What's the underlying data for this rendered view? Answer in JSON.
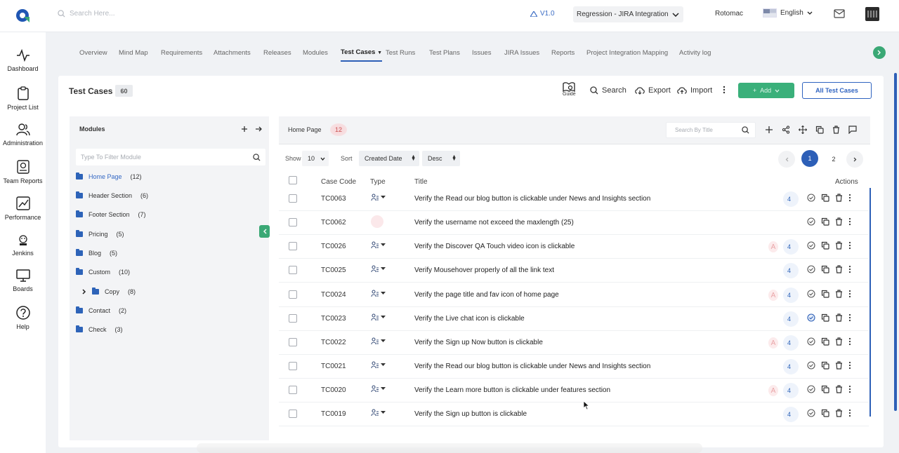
{
  "topbar": {
    "search_placeholder": "Search Here...",
    "version": "V1.0",
    "project": "Regression - JIRA Integration",
    "user": "Rotomac",
    "language": "English"
  },
  "sidebar": {
    "items": [
      {
        "label": "Dashboard",
        "icon": "pulse-icon"
      },
      {
        "label": "Project List",
        "icon": "clipboard-icon"
      },
      {
        "label": "Administration",
        "icon": "users-icon"
      },
      {
        "label": "Team Reports",
        "icon": "report-icon"
      },
      {
        "label": "Performance",
        "icon": "performance-icon"
      },
      {
        "label": "Jenkins",
        "icon": "jenkins-icon"
      },
      {
        "label": "Boards",
        "icon": "monitor-icon"
      },
      {
        "label": "Help",
        "icon": "help-icon"
      }
    ]
  },
  "tabs": [
    "Overview",
    "Mind Map",
    "Requirements",
    "Attachments",
    "Releases",
    "Modules",
    "Test Cases",
    "Test Runs",
    "Test Plans",
    "Issues",
    "JIRA Issues",
    "Reports",
    "Project Integration Mapping",
    "Activity log"
  ],
  "header": {
    "title": "Test Cases",
    "count": "60",
    "guide": "Guide",
    "search": "Search",
    "export": "Export",
    "import": "Import",
    "add": "Add",
    "all": "All Test Cases"
  },
  "modules": {
    "title": "Modules",
    "filter_placeholder": "Type To Filter Module",
    "items": [
      {
        "name": "Home Page",
        "count": "(12)"
      },
      {
        "name": "Header Section",
        "count": "(6)"
      },
      {
        "name": "Footer Section",
        "count": "(7)"
      },
      {
        "name": "Pricing",
        "count": "(5)"
      },
      {
        "name": "Blog",
        "count": "(5)"
      },
      {
        "name": "Custom",
        "count": "(10)"
      },
      {
        "name": "Copy",
        "count": "(8)"
      },
      {
        "name": "Contact",
        "count": "(2)"
      },
      {
        "name": "Check",
        "count": "(3)"
      }
    ]
  },
  "list": {
    "module": "Home Page",
    "count": "12",
    "search_placeholder": "Search By Title",
    "show_label": "Show",
    "show_value": "10",
    "sort_label": "Sort",
    "sort_value": "Created Date",
    "order_value": "Desc",
    "pages": [
      "1",
      "2"
    ],
    "headers": {
      "code": "Case Code",
      "type": "Type",
      "title": "Title",
      "actions": "Actions"
    },
    "rows": [
      {
        "code": "TC0063",
        "title": "Verify the Read our blog button is clickable under News and Insights section",
        "count": "4",
        "a": false
      },
      {
        "code": "TC0062",
        "title": "Verify the username not exceed the maxlength (25)",
        "count": "",
        "a": false
      },
      {
        "code": "TC0026",
        "title": "Verify the Discover QA Touch video icon is clickable",
        "count": "4",
        "a": true
      },
      {
        "code": "TC0025",
        "title": "Verify Mousehover properly of all the link text",
        "count": "4",
        "a": false
      },
      {
        "code": "TC0024",
        "title": "Verify the page title and fav icon of home page",
        "count": "4",
        "a": true
      },
      {
        "code": "TC0023",
        "title": "Verify the Live chat icon is clickable",
        "count": "4",
        "a": false
      },
      {
        "code": "TC0022",
        "title": "Verify the Sign up Now button is clickable",
        "count": "4",
        "a": true
      },
      {
        "code": "TC0021",
        "title": "Verify the Read our blog button is clickable under News and Insights section",
        "count": "4",
        "a": false
      },
      {
        "code": "TC0020",
        "title": "Verify the Learn more button is clickable under features section",
        "count": "4",
        "a": true
      },
      {
        "code": "TC0019",
        "title": "Verify the Sign up button is clickable",
        "count": "4",
        "a": false
      }
    ],
    "a_label": "A"
  },
  "colors": {
    "accent": "#2d5fb7",
    "green": "#3aa875"
  }
}
